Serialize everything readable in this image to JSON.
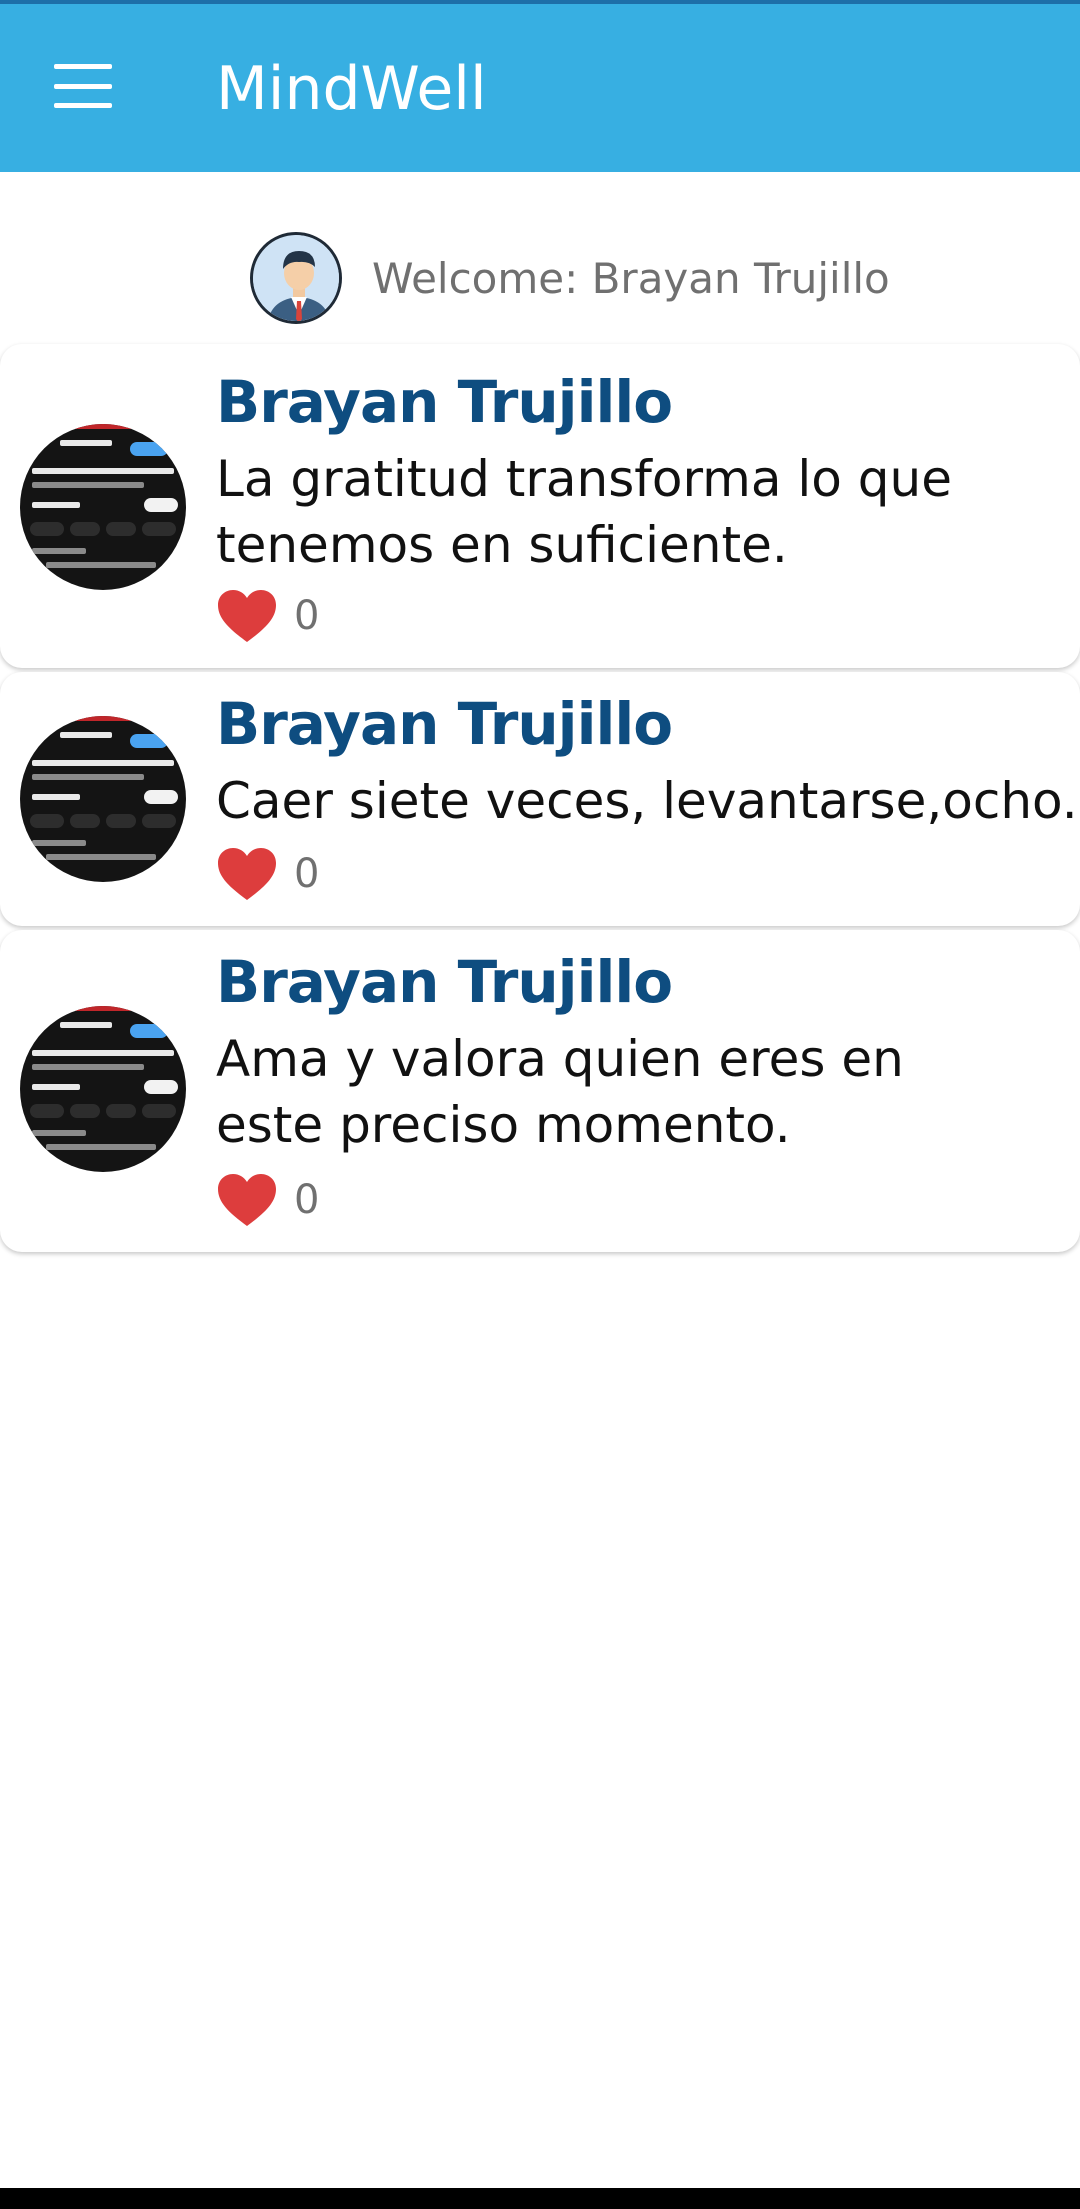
{
  "app": {
    "title": "MindWell",
    "accent_color": "#37afe2",
    "menu_icon": "hamburger-menu-icon"
  },
  "welcome": {
    "text": "Welcome: Brayan Trujillo",
    "avatar_icon": "user-avatar-icon"
  },
  "posts": [
    {
      "author": "Brayan Trujillo",
      "text": "La gratitud transforma lo que tenemos en suficiente.",
      "likes": "0"
    },
    {
      "author": "Brayan Trujillo",
      "text": "Caer siete veces, levantarse,ocho.",
      "likes": "0"
    },
    {
      "author": "Brayan Trujillo",
      "text": "Ama y valora quien eres en este preciso momento.",
      "likes": "0"
    }
  ],
  "colors": {
    "author": "#0e4d80",
    "heart": "#dd3d3d",
    "secondary_text": "#707070"
  }
}
